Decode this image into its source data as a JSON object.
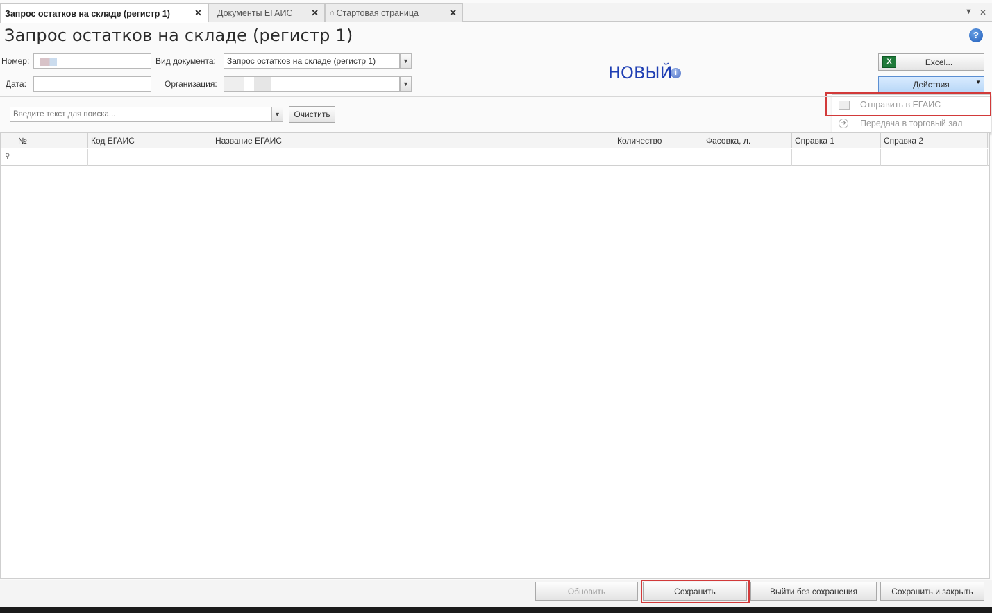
{
  "tabs": [
    {
      "label": "Запрос остатков на складе (регистр 1)",
      "active": true
    },
    {
      "label": "Документы ЕГАИС",
      "active": false
    },
    {
      "label": "Стартовая страница",
      "active": false,
      "icon": "home-icon"
    }
  ],
  "page_title": "Запрос остатков на складе (регистр 1)",
  "form": {
    "number_label": "Номер:",
    "date_label": "Дата:",
    "doc_type_label": "Вид документа:",
    "doc_type_value": "Запрос остатков на складе (регистр 1)",
    "org_label": "Организация:"
  },
  "status": "НОВЫЙ",
  "buttons": {
    "excel": "Excel...",
    "actions": "Действия",
    "clear": "Очистить",
    "refresh": "Обновить",
    "save": "Сохранить",
    "exit_no_save": "Выйти без сохранения",
    "save_close": "Сохранить и закрыть"
  },
  "actions_menu": [
    {
      "label": "Отправить в ЕГАИС",
      "icon": "envelope-icon",
      "highlighted": true
    },
    {
      "label": "Передача в торговый зал",
      "icon": "arrow-right-circle-icon",
      "highlighted": false
    }
  ],
  "search": {
    "placeholder": "Введите текст для поиска..."
  },
  "grid": {
    "columns": [
      "№",
      "Код ЕГАИС",
      "Название ЕГАИС",
      "Количество",
      "Фасовка, л.",
      "Справка 1",
      "Справка 2"
    ]
  },
  "colors": {
    "status": "#1f3fb3",
    "highlight": "#d23a3a",
    "actions_button": "#b8d7f7"
  }
}
